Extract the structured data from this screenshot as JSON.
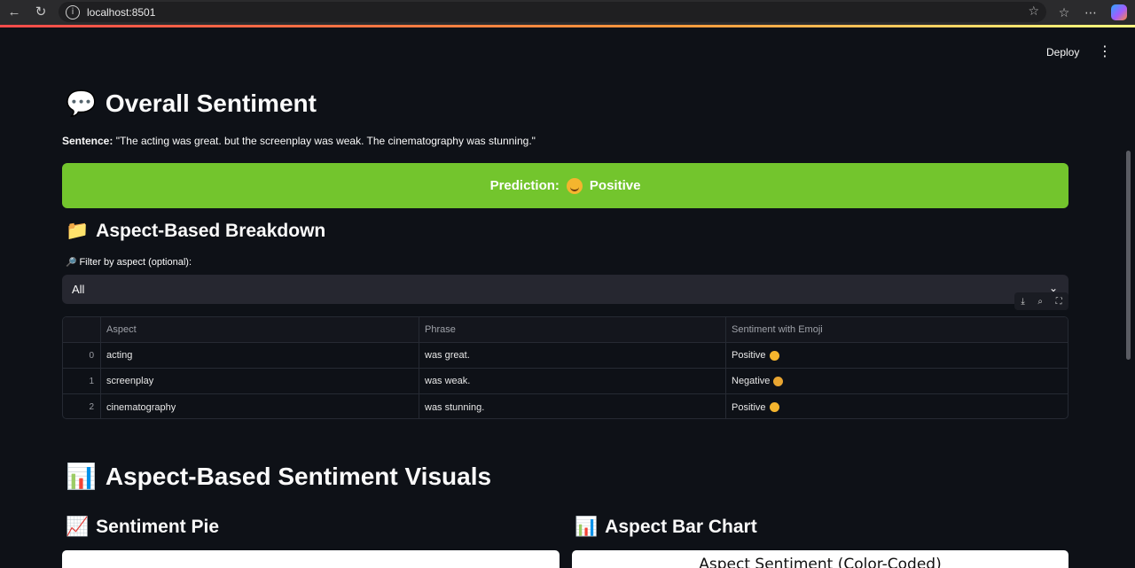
{
  "browser": {
    "back_icon": "arrow-left-icon",
    "reload_icon": "reload-icon",
    "url": "localhost:8501",
    "star_icon": "star-icon",
    "favorites_icon": "favorites-icon",
    "menu_icon": "more-icon",
    "copilot_icon": "copilot-icon"
  },
  "app": {
    "deploy_label": "Deploy",
    "menu_label": "⋮"
  },
  "overall": {
    "emoji": "💬",
    "title": "Overall Sentiment",
    "sentence_label": "Sentence:",
    "sentence_text": " \"The acting was great. but the screenplay was weak. The cinematography was stunning.\"",
    "prediction_label": "Prediction:",
    "prediction_value": "Positive",
    "prediction_color": "#73c52d"
  },
  "breakdown": {
    "emoji": "📁",
    "title": "Aspect-Based Breakdown",
    "filter_emoji": "🔎",
    "filter_label": "Filter by aspect (optional):",
    "filter_value": "All",
    "columns": [
      "",
      "Aspect",
      "Phrase",
      "Sentiment with Emoji"
    ],
    "rows": [
      {
        "index": "0",
        "aspect": "acting",
        "phrase": "was great.",
        "sentiment": "Positive"
      },
      {
        "index": "1",
        "aspect": "screenplay",
        "phrase": "was weak.",
        "sentiment": "Negative"
      },
      {
        "index": "2",
        "aspect": "cinematography",
        "phrase": "was stunning.",
        "sentiment": "Positive"
      }
    ]
  },
  "visuals": {
    "emoji": "📊",
    "title": "Aspect-Based Sentiment Visuals",
    "pie_emoji": "📈",
    "pie_title": "Sentiment Pie",
    "bar_emoji": "📊",
    "bar_title": "Aspect Bar Chart",
    "bar_chart_title": "Aspect Sentiment (Color-Coded)"
  }
}
